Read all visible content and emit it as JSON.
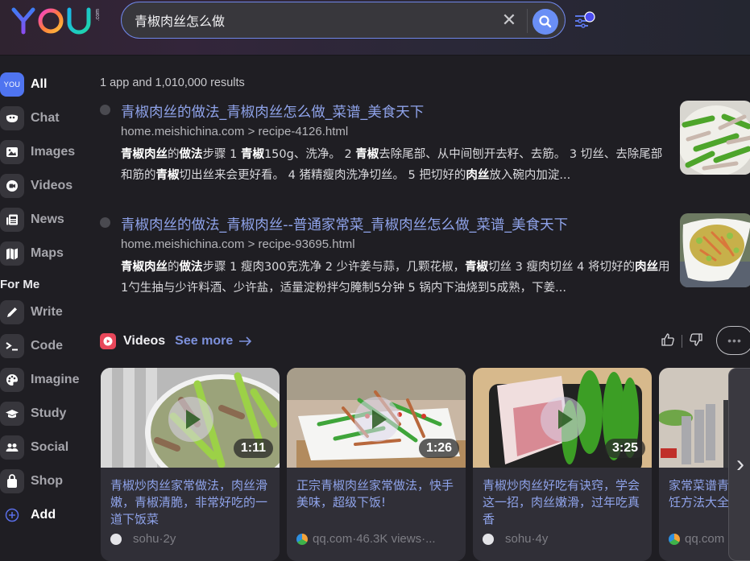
{
  "header": {
    "logo_text": "YOU",
    "logo_suffix": ".com",
    "search": {
      "value": "青椒肉丝怎么做",
      "clear_icon": "close-icon",
      "submit_icon": "search-icon"
    },
    "filter_icon": "sliders-icon"
  },
  "sidebar": {
    "items": [
      {
        "label": "All",
        "icon": "you-logo-icon",
        "icon_text": "YOU",
        "active": true
      },
      {
        "label": "Chat",
        "icon": "chat-icon"
      },
      {
        "label": "Images",
        "icon": "image-icon"
      },
      {
        "label": "Videos",
        "icon": "video-icon"
      },
      {
        "label": "News",
        "icon": "news-icon"
      },
      {
        "label": "Maps",
        "icon": "map-icon"
      }
    ],
    "section_label": "For Me",
    "apps": [
      {
        "label": "Write",
        "icon": "pencil-icon"
      },
      {
        "label": "Code",
        "icon": "terminal-icon"
      },
      {
        "label": "Imagine",
        "icon": "palette-icon"
      },
      {
        "label": "Study",
        "icon": "graduation-cap-icon"
      },
      {
        "label": "Social",
        "icon": "people-icon"
      },
      {
        "label": "Shop",
        "icon": "shopping-bag-icon"
      }
    ],
    "add_label": "Add"
  },
  "main": {
    "results_count": "1 app and 1,010,000 results",
    "results": [
      {
        "title": "青椒肉丝的做法_青椒肉丝怎么做_菜谱_美食天下",
        "url": "home.meishichina.com > recipe-4126.html",
        "snippet_html": "<b>青椒肉丝</b>的<b>做法</b>步骤 1 <b>青椒</b>150g、洗净。 2 <b>青椒</b>去除尾部、从中间刨开去籽、去筋。 3 切丝、去除尾部和筋的<b>青椒</b>切出丝来会更好看。 4 猪精瘦肉洗净切丝。 5 把切好的<b>肉丝</b>放入碗内加淀..."
      },
      {
        "title": "青椒肉丝的做法_青椒肉丝--普通家常菜_青椒肉丝怎么做_菜谱_美食天下",
        "url": "home.meishichina.com > recipe-93695.html",
        "snippet_html": "<b>青椒肉丝</b>的<b>做法</b>步骤 1 瘦肉300克洗净 2 少许姜与蒜，几颗花椒，<b>青椒</b>切丝 3 瘦肉切丝 4 将切好的<b>肉丝</b>用1勺生抽与少许料酒、少许盐，适量淀粉拌匀腌制5分钟 5 锅内下油烧到5成熟，下姜..."
      }
    ],
    "videos": {
      "title": "Videos",
      "see_more": "See more",
      "items": [
        {
          "title": "青椒炒肉丝家常做法，肉丝滑嫩，青椒清脆，非常好吃的一道下饭菜",
          "duration": "1:11",
          "source": "sohu",
          "meta": "·2y"
        },
        {
          "title": "正宗青椒肉丝家常做法，快手美味，超级下饭!",
          "duration": "1:26",
          "source": "qq.com",
          "meta": "·46.3K views·..."
        },
        {
          "title": "青椒炒肉丝好吃有诀窍，学会这一招，肉丝嫩滑，过年吃真香",
          "duration": "3:25",
          "source": "sohu",
          "meta": "·4y"
        },
        {
          "title": "家常菜谱青椒肉丝，好吃的烹饪方法大全",
          "duration": "",
          "source": "qq.com",
          "meta": ""
        }
      ]
    }
  }
}
